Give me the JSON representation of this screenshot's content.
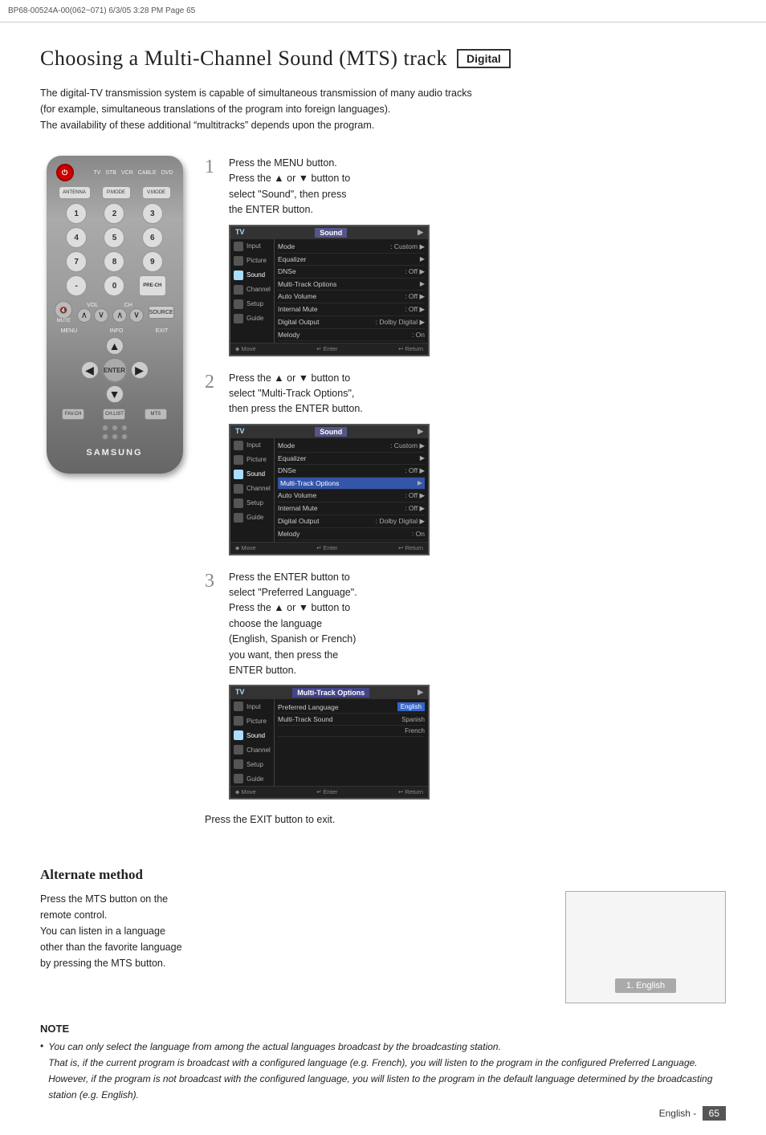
{
  "header": {
    "text": "BP68-00524A-00(062~071)   6/3/05   3:28 PM   Page 65"
  },
  "title": {
    "main": "Choosing a Multi-Channel Sound (MTS) track",
    "badge": "Digital"
  },
  "intro": {
    "line1": "The digital-TV transmission system is capable of simultaneous transmission of many audio tracks",
    "line2": "(for example, simultaneous translations of the program into foreign languages).",
    "line3": "The availability of these additional “multitracks” depends upon the program."
  },
  "steps": [
    {
      "number": "1",
      "text": "Press the MENU button.\nPress the ▲ or ▼ button to\nselect “Sound”, then press\nthe ENTER button."
    },
    {
      "number": "2",
      "text": "Press the ▲ or ▼ button to\nselect “Multi-Track Options”,\nthen press the ENTER button."
    },
    {
      "number": "3",
      "text": "Press the ENTER button to\nselect “Preferred Language”.\nPress the ▲ or ▼ button to\nchoose the language\n(English, Spanish or French)\nyou want, then press the\nENTER button."
    }
  ],
  "exit_note": "Press the EXIT button to exit.",
  "tv_screens": {
    "screen1": {
      "header_left": "TV",
      "header_right": "Sound",
      "sidebar": [
        "Input",
        "Picture",
        "Sound",
        "Channel",
        "Setup",
        "Guide"
      ],
      "rows": [
        {
          "label": "Mode",
          "value": ": Custom",
          "arrow": true
        },
        {
          "label": "Equalizer",
          "value": "",
          "arrow": true
        },
        {
          "label": "DNSe",
          "value": ": Off",
          "arrow": true
        },
        {
          "label": "Multi-Track Options",
          "value": "",
          "arrow": true
        },
        {
          "label": "Auto Volume",
          "value": ": Off",
          "arrow": true
        },
        {
          "label": "Internal Mute",
          "value": ": Off",
          "arrow": true
        },
        {
          "label": "Digital Output",
          "value": ": Dolby Digital",
          "arrow": true
        },
        {
          "label": "Melody",
          "value": ": On",
          "arrow": false
        }
      ],
      "footer": [
        "Move",
        "Enter",
        "Return"
      ]
    },
    "screen2": {
      "header_left": "TV",
      "header_right": "Sound",
      "highlighted_row": "Multi-Track Options",
      "sidebar": [
        "Input",
        "Picture",
        "Sound",
        "Channel",
        "Setup",
        "Guide"
      ],
      "rows": [
        {
          "label": "Mode",
          "value": ": Custom",
          "arrow": true
        },
        {
          "label": "Equalizer",
          "value": "",
          "arrow": true
        },
        {
          "label": "DNSe",
          "value": ": Off",
          "arrow": true
        },
        {
          "label": "Multi-Track Options",
          "value": "",
          "arrow": true,
          "highlight": true
        },
        {
          "label": "Auto Volume",
          "value": ": Off",
          "arrow": true
        },
        {
          "label": "Internal Mute",
          "value": ": Off",
          "arrow": true
        },
        {
          "label": "Digital Output",
          "value": ": Dolby Digital",
          "arrow": true
        },
        {
          "label": "Melody",
          "value": ": On",
          "arrow": false
        }
      ],
      "footer": [
        "Move",
        "Enter",
        "Return"
      ]
    },
    "screen3": {
      "header_left": "TV",
      "header_right": "Multi-Track Options",
      "sidebar": [
        "Input",
        "Picture",
        "Sound",
        "Channel",
        "Setup",
        "Guide"
      ],
      "rows": [
        {
          "label": "Preferred Language",
          "value": "English",
          "highlight": true
        },
        {
          "label": "Multi-Track Sound",
          "value": "Spanish"
        },
        {
          "label": "",
          "value": "French"
        }
      ],
      "footer": [
        "Move",
        "Enter",
        "Return"
      ]
    }
  },
  "alternate_method": {
    "title": "Alternate method",
    "text_lines": [
      "Press the MTS button on the",
      "remote control.",
      "You can listen in a language",
      "other than the favorite language",
      "by pressing the MTS button."
    ],
    "screen_badge": "1. English"
  },
  "note": {
    "title": "NOTE",
    "bullet": "You can only select the language from among the actual languages broadcast by the broadcasting station.\nThat is, if the current program is broadcast with a configured language (e.g. French), you will listen to the program in the configured Preferred Language. However, if the program is not broadcast with the configured language, you will listen to the program in the default language determined by the broadcasting station (e.g. English)."
  },
  "footer": {
    "text": "English - 65"
  },
  "remote": {
    "brand": "SAMSUNG",
    "power": "POWER",
    "labels": [
      "TV",
      "STB",
      "VCR",
      "CABLE",
      "DVD"
    ],
    "buttons": [
      "ANTENNA",
      "P.MODE",
      "V.MODE"
    ],
    "numbers": [
      "1",
      "2",
      "3",
      "4",
      "5",
      "6",
      "7",
      "8",
      "9",
      "-",
      "0",
      "PRE-CH"
    ],
    "func_btns": [
      "MUTE",
      "VOL",
      "CH",
      "SOURCE"
    ],
    "nav_labels": [
      "MENU",
      "INFO",
      "EXIT"
    ],
    "nav_center": "ENTER",
    "bottom_btns": [
      "FAV.CH",
      "CH.LIST",
      "MTS"
    ]
  }
}
